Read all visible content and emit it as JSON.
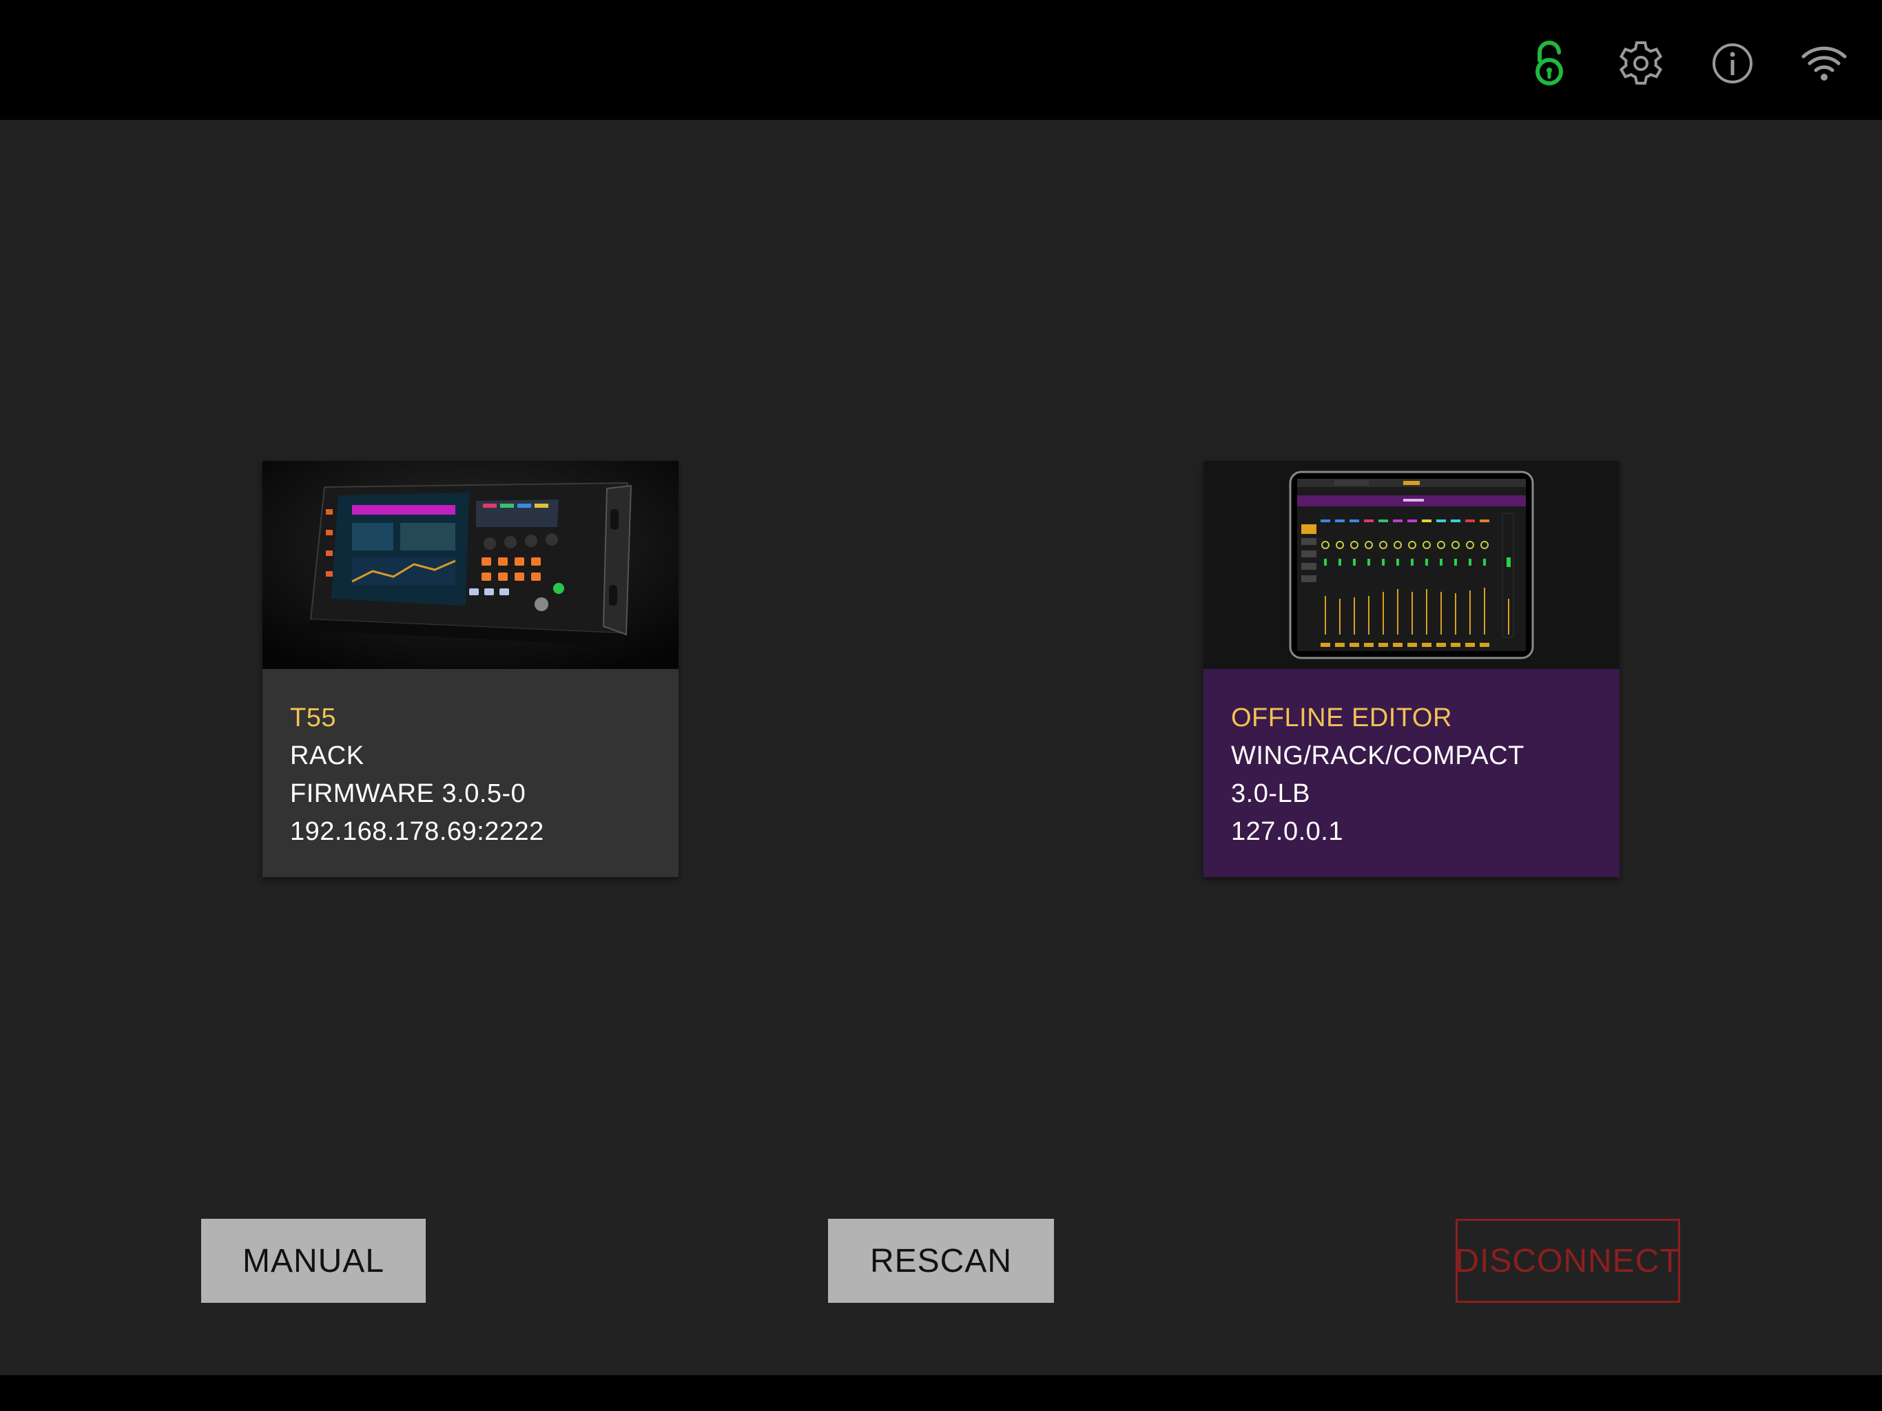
{
  "topbar": {
    "icons": [
      {
        "name": "unlock-icon",
        "color": "#1fb83f"
      },
      {
        "name": "gear-icon",
        "color": "#9a9a9a"
      },
      {
        "name": "info-icon",
        "color": "#9a9a9a"
      },
      {
        "name": "wifi-icon",
        "color": "#9a9a9a"
      }
    ]
  },
  "devices": [
    {
      "name": "T55",
      "type": "RACK",
      "version": "FIRMWARE 3.0.5-0",
      "address": "192.168.178.69:2222",
      "info_bg": "#333333",
      "image": "wing-rack-console-photo"
    },
    {
      "name": "OFFLINE EDITOR",
      "type": "WING/RACK/COMPACT",
      "version": "3.0-LB",
      "address": "127.0.0.1",
      "info_bg": "#3a1a4a",
      "image": "tablet-mixer-screenshot"
    }
  ],
  "buttons": {
    "manual": "MANUAL",
    "rescan": "RESCAN",
    "disconnect": "DISCONNECT"
  },
  "colors": {
    "accent_name": "#f2c255",
    "disconnect": "#8c1f1f",
    "lock_active": "#1fb83f"
  }
}
